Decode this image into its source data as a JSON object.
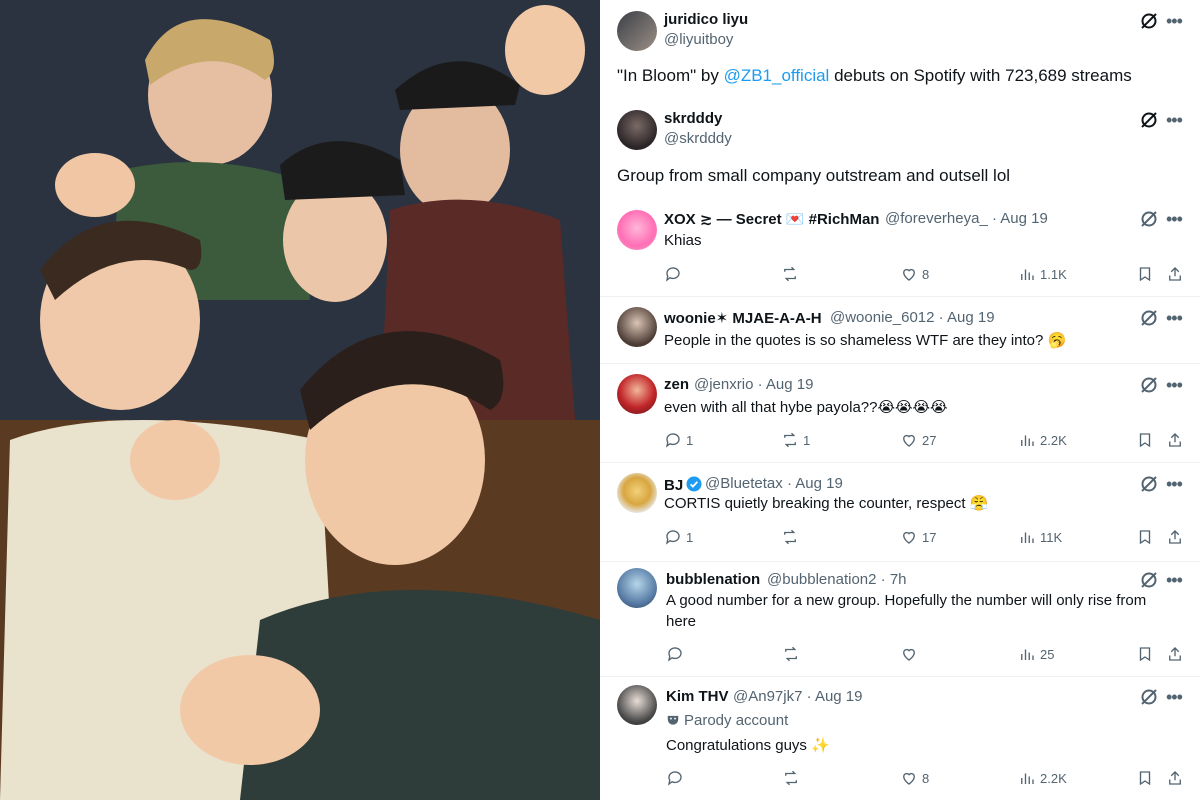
{
  "main_post": {
    "author_name": "juridico liyu",
    "author_handle": "@liyuitboy",
    "text_before": "\"In Bloom\" by ",
    "mention": "@ZB1_official",
    "text_after": " debuts on Spotify with 723,689 streams"
  },
  "quoted_post": {
    "author_name": "skrdddy",
    "author_handle": "@skrdddy",
    "text": "Group from small company outstream and outsell lol"
  },
  "replies": [
    {
      "name": "XOX ≳ — Secret 💌 #RichMan",
      "handle": "@foreverheya_",
      "time": "· Aug 19",
      "text": "Khias",
      "replies": "",
      "reposts": "",
      "likes": "8",
      "views": "1.1K"
    },
    {
      "name": "woonie✶ MJAE-A-A-H",
      "handle": "@woonie_6012",
      "time": "· Aug 19",
      "text": "People in the quotes is so shameless WTF are they into? 🥱"
    },
    {
      "name": "zen",
      "handle": "@jenxrio",
      "time": "· Aug 19",
      "text": "even with all that hybe payola??😭😭😭😭",
      "replies": "1",
      "reposts": "1",
      "likes": "27",
      "views": "2.2K"
    },
    {
      "name": "BJ",
      "handle": "@Bluetetax",
      "time": "· Aug 19",
      "text": "CORTIS quietly breaking the counter, respect 😤",
      "replies": "1",
      "reposts": "",
      "likes": "17",
      "views": "11K"
    },
    {
      "name": "bubblenation",
      "handle": "@bubblenation2",
      "time": "· 7h",
      "text": "A good number for a new group. Hopefully the number will only rise from here",
      "replies": "",
      "reposts": "",
      "likes": "",
      "views": "25"
    },
    {
      "name": "Kim THV",
      "handle": "@An97jk7",
      "time": "· Aug 19",
      "parody_label": "Parody account",
      "text": "Congratulations guys ✨",
      "replies": "",
      "reposts": "",
      "likes": "8",
      "views": "2.2K"
    }
  ],
  "colors": {
    "link": "#1d9bf0",
    "secondary_text": "#536471",
    "verified": "#1d9bf0"
  },
  "icons": [
    "grok-icon",
    "more-icon",
    "reply-icon",
    "repost-icon",
    "like-icon",
    "views-icon",
    "bookmark-icon",
    "share-icon",
    "verified-badge-icon",
    "parody-mask-icon"
  ]
}
